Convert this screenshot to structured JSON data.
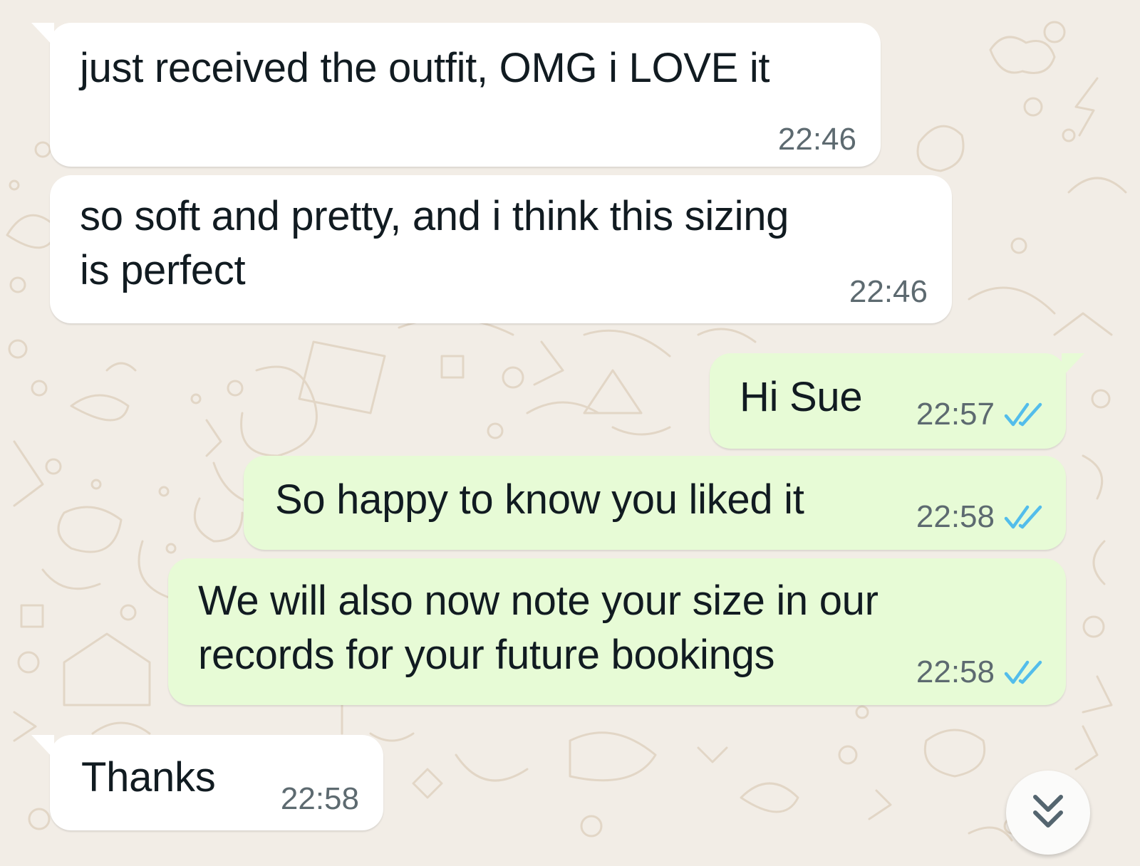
{
  "chat": {
    "messages": [
      {
        "direction": "incoming",
        "text": "just received the outfit, OMG i LOVE it",
        "time": "22:46"
      },
      {
        "direction": "incoming",
        "text_lines": [
          "so soft and pretty, and i think this sizing",
          "is perfect"
        ],
        "time": "22:46"
      },
      {
        "direction": "outgoing",
        "text": "Hi Sue",
        "time": "22:57",
        "status": "read"
      },
      {
        "direction": "outgoing",
        "text": "So happy to know you liked it",
        "time": "22:58",
        "status": "read"
      },
      {
        "direction": "outgoing",
        "text_lines": [
          "We will also now note your size in our",
          "records for your future bookings"
        ],
        "time": "22:58",
        "status": "read"
      },
      {
        "direction": "incoming",
        "text": "Thanks",
        "time": "22:58"
      }
    ],
    "read_receipt_icon": "double-check-icon",
    "scroll_down_icon": "double-chevron-down-icon"
  },
  "colors": {
    "wallpaper": "#f2ede6",
    "wallpaper_doodle": "#e2d6c6",
    "incoming_bubble": "#ffffff",
    "outgoing_bubble": "#e7fbd6",
    "read_tick": "#53bdeb",
    "timestamp": "#5d6a70"
  }
}
